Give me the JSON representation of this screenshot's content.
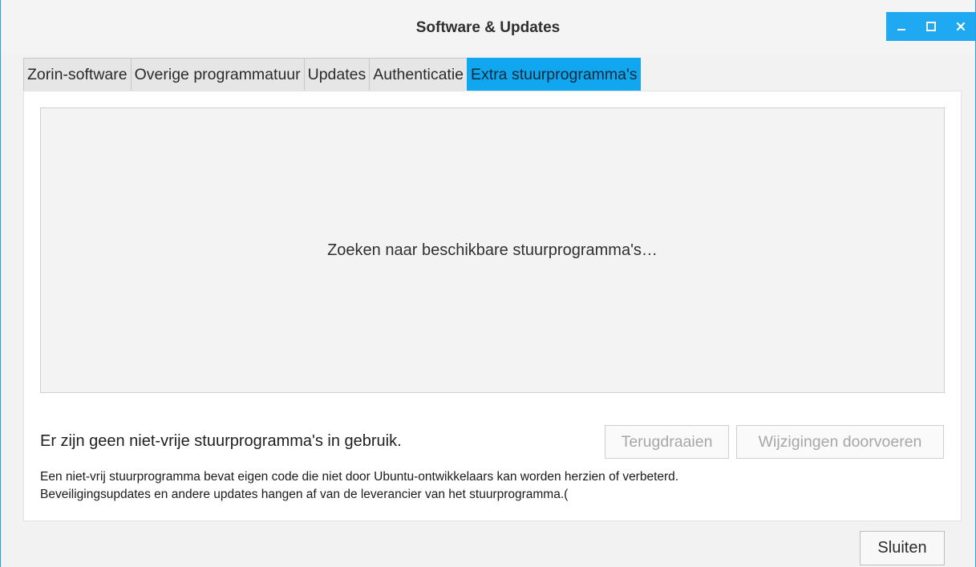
{
  "window": {
    "title": "Software & Updates",
    "controls": {
      "minimize_icon": "minimize-icon",
      "maximize_icon": "maximize-icon",
      "close_icon": "close-icon"
    },
    "accent_color": "#1fa9f2"
  },
  "tabs": [
    {
      "label": "Zorin-software",
      "active": false
    },
    {
      "label": "Overige programmatuur",
      "active": false
    },
    {
      "label": "Updates",
      "active": false
    },
    {
      "label": "Authenticatie",
      "active": false
    },
    {
      "label": "Extra stuurprogramma's",
      "active": true
    }
  ],
  "drivers": {
    "searching_text": "Zoeken naar beschikbare stuurprogramma's…",
    "status_text": "Er zijn geen niet-vrije stuurprogramma's in gebruik.",
    "revert_label": "Terugdraaien",
    "apply_label": "Wijzigingen doorvoeren",
    "info_line_1": " Een niet-vrij stuurprogramma bevat eigen code die niet door Ubuntu-ontwikkelaars kan worden herzien of verbeterd.",
    "info_line_2": "Beveiligingsupdates en andere updates hangen af van de leverancier van het stuurprogramma.("
  },
  "footer": {
    "close_label": "Sluiten"
  }
}
